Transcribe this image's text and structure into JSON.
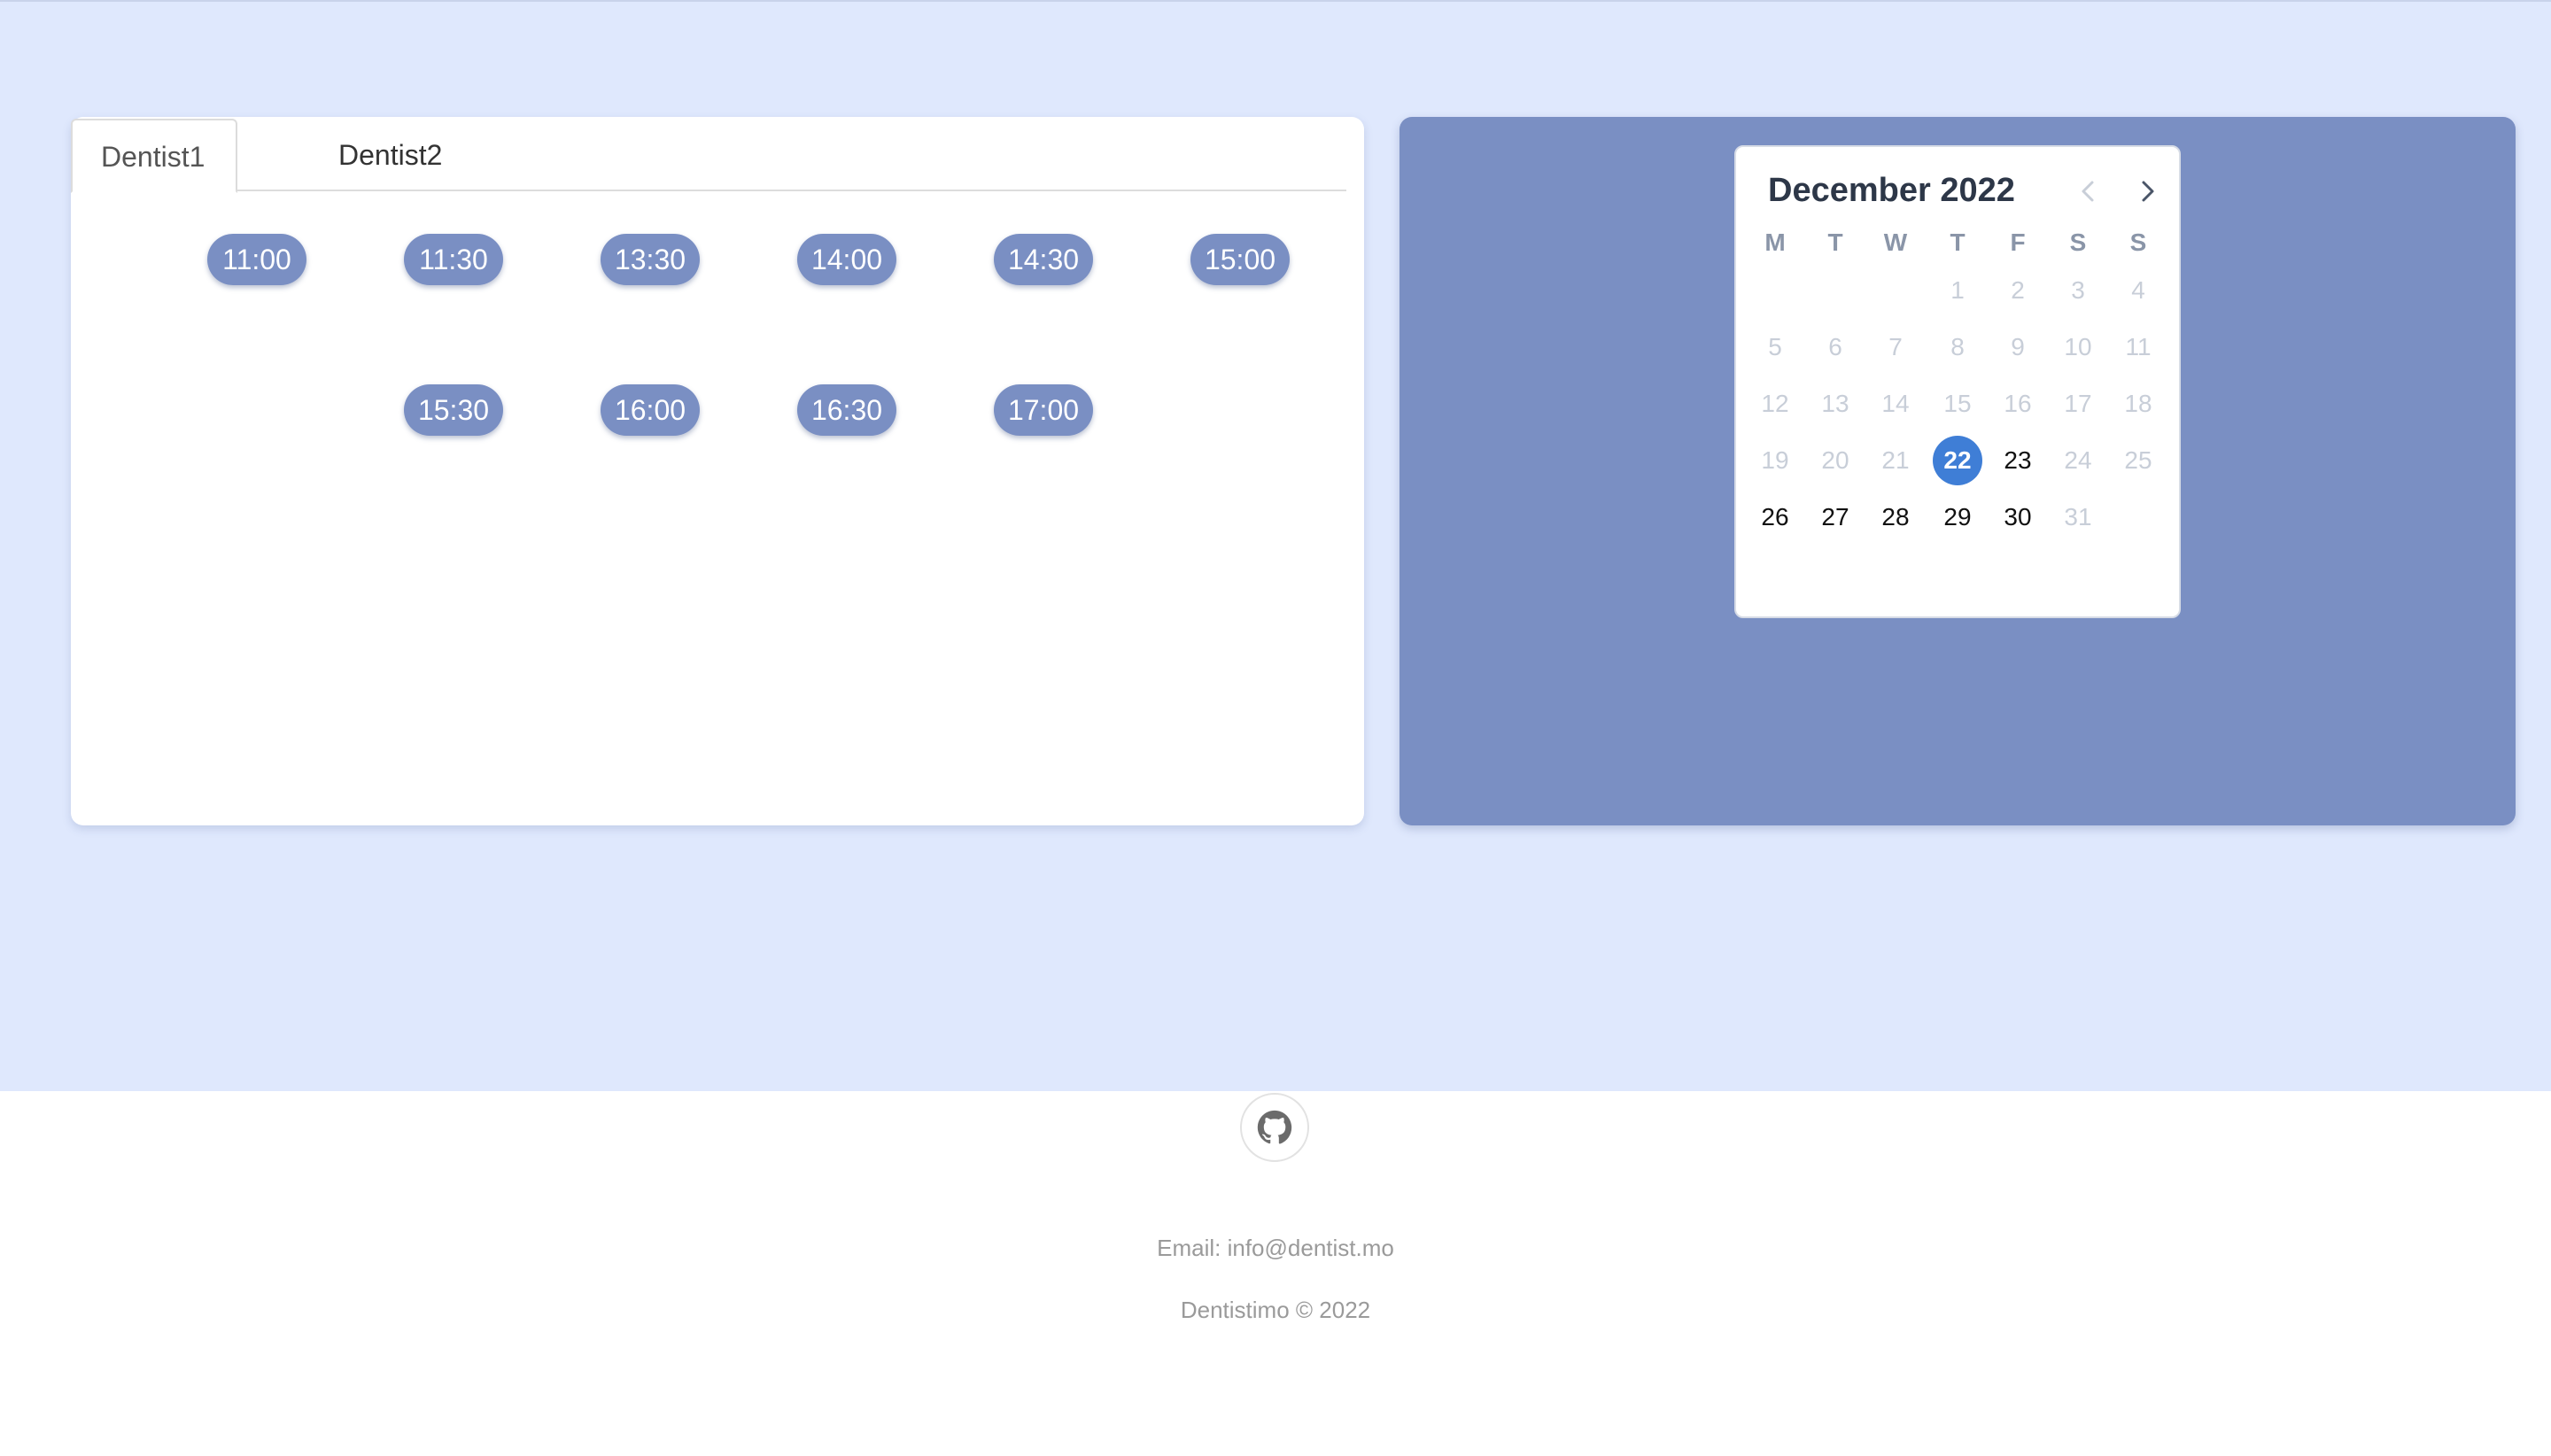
{
  "tabs": [
    {
      "label": "Dentist1",
      "active": true
    },
    {
      "label": "Dentist2",
      "active": false
    }
  ],
  "time_slots": [
    "11:00",
    "11:30",
    "13:30",
    "14:00",
    "14:30",
    "15:00",
    "15:30",
    "16:00",
    "16:30",
    "17:00"
  ],
  "calendar": {
    "month_title": "December 2022",
    "weekdays": [
      "M",
      "T",
      "W",
      "T",
      "F",
      "S",
      "S"
    ],
    "weeks": [
      [
        "",
        "",
        "",
        "1",
        "2",
        "3",
        "4"
      ],
      [
        "5",
        "6",
        "7",
        "8",
        "9",
        "10",
        "11"
      ],
      [
        "12",
        "13",
        "14",
        "15",
        "16",
        "17",
        "18"
      ],
      [
        "19",
        "20",
        "21",
        "22",
        "23",
        "24",
        "25"
      ],
      [
        "26",
        "27",
        "28",
        "29",
        "30",
        "31",
        ""
      ]
    ],
    "selected": "22",
    "enabled_days": [
      "22",
      "23",
      "26",
      "27",
      "28",
      "29",
      "30"
    ],
    "prev_icon": "chevron-left-icon",
    "next_icon": "chevron-right-icon"
  },
  "footer": {
    "github_icon": "github-icon",
    "email": "Email: info@dentist.mo",
    "copyright": "Dentistimo © 2022"
  },
  "colors": {
    "page_bg": "#dfe8fd",
    "accent": "#7a8fc3",
    "selected_day": "#3f7ed6"
  }
}
